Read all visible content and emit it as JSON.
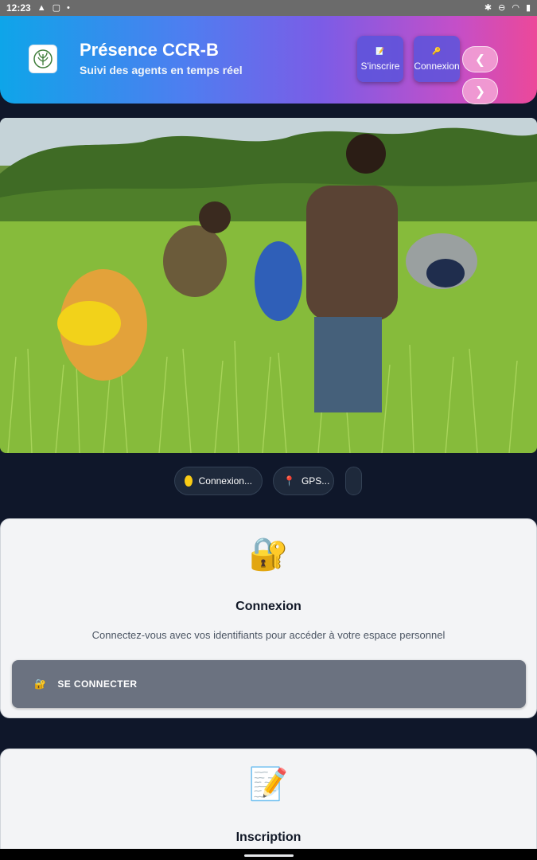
{
  "status_bar": {
    "time": "12:23",
    "left_icons": [
      "warning-icon",
      "square-icon",
      "dot-icon"
    ],
    "right_icons": [
      "bluetooth-icon",
      "dnd-icon",
      "wifi-icon",
      "battery-icon"
    ]
  },
  "header": {
    "title": "Présence CCR-B",
    "subtitle": "Suivi des agents en temps réel",
    "buttons": [
      {
        "label": "S'inscrire",
        "icon": "memo-icon"
      },
      {
        "label": "Connexion",
        "icon": "key-icon"
      }
    ],
    "nav_prev": "❮",
    "nav_next": "❯"
  },
  "chips": [
    {
      "label": "Connexion...",
      "icon": "yellow-dot-icon"
    },
    {
      "label": "GPS...",
      "icon": "pin-icon"
    },
    {
      "label": ""
    }
  ],
  "login_card": {
    "emoji": "🔐",
    "title": "Connexion",
    "description": "Connectez-vous avec vos identifiants pour accéder à votre espace personnel",
    "button_label": "SE CONNECTER",
    "button_icon": "🔐"
  },
  "register_card": {
    "emoji": "📝",
    "title": "Inscription"
  },
  "colors": {
    "background": "#0f172a",
    "card": "#f3f4f6",
    "login_button": "#6b7280",
    "header_gradient_start": "#0ea5e9",
    "header_gradient_end": "#ec4899"
  }
}
